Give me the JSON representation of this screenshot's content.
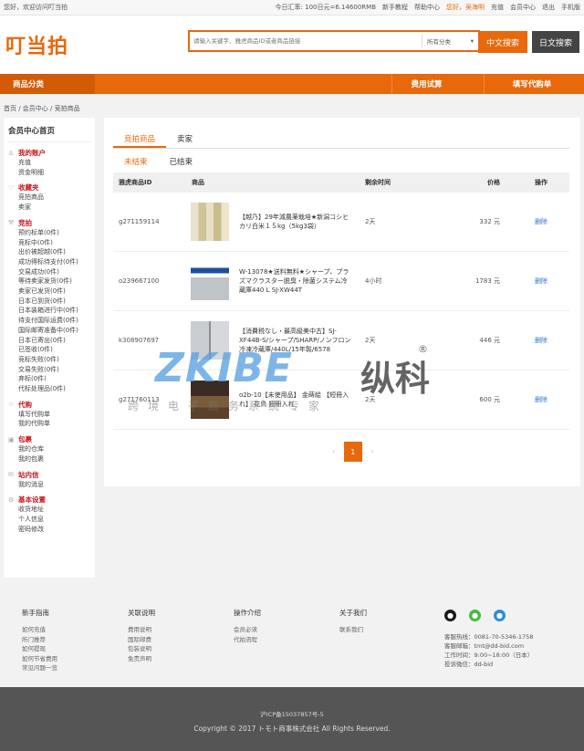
{
  "topbar": {
    "welcome": "您好，欢迎访问叮当拍",
    "rate": "今日汇率: 100日元=6.14600RMB",
    "links": [
      "新手教程",
      "帮助中心"
    ],
    "greeting": "您好，吴海明",
    "links2": [
      "充值",
      "会员中心",
      "退出",
      "手机版"
    ]
  },
  "header": {
    "logo": "叮当拍",
    "search_placeholder": "请输入关键字、雅虎商品ID或者商品链接",
    "category": "所有分类",
    "btn_cn": "中文搜索",
    "btn_jp": "日文搜索"
  },
  "nav": {
    "category_title": "商品分类",
    "items": [
      "费用试算",
      "填写代购单"
    ]
  },
  "breadcrumb": "首页 / 会员中心 / 竞拍商品",
  "sidebar": {
    "home": "会员中心首页",
    "groups": [
      {
        "title": "我的账户",
        "icon": "user-icon",
        "items": [
          "充值",
          "资金明细"
        ]
      },
      {
        "title": "收藏夹",
        "icon": "heart-icon",
        "items": [
          "竞拍商品",
          "卖家"
        ]
      },
      {
        "title": "竞拍",
        "icon": "gavel-icon",
        "items": [
          "预约标单(0件)",
          "竞标中(0件)",
          "出价被超越(0件)",
          "成功得标待支付(0件)",
          "交易成功(0件)",
          "等待卖家发货(0件)",
          "卖家已发货(0件)",
          "日本已到货(0件)",
          "日本装箱进行中(0件)",
          "待支付国际运费(0件)",
          "国际邮寄准备中(0件)",
          "日本已寄出(0件)",
          "已签收(0件)",
          "竞标失败(0件)",
          "交易失败(0件)",
          "弃标(0件)",
          "代标处理品(0件)"
        ]
      },
      {
        "title": "代购",
        "icon": "star-icon",
        "items": [
          "填写代购单",
          "我的代购单"
        ]
      },
      {
        "title": "包裹",
        "icon": "package-icon",
        "items": [
          "我的仓库",
          "我的包裹"
        ]
      },
      {
        "title": "站内信",
        "icon": "mail-icon",
        "items": [
          "我的消息"
        ]
      },
      {
        "title": "基本设置",
        "icon": "settings-icon",
        "items": [
          "收货地址",
          "个人信息",
          "密码修改"
        ]
      }
    ]
  },
  "main": {
    "tabs": [
      "竞拍商品",
      "卖家"
    ],
    "subtabs": [
      "未结束",
      "已结束"
    ],
    "columns": [
      "雅虎商品ID",
      "商品",
      "剩余时间",
      "价格",
      "操作"
    ],
    "rows": [
      {
        "id": "g271159114",
        "title": "【越乃】29年減農薬栽培★新潟コシヒカリ白米１５kg（5kg3袋）",
        "time": "2天",
        "price": "332 元",
        "op": "删除"
      },
      {
        "id": "o239667100",
        "title": "W-13078★送料無料★シャープ、プラズマクラスター脱臭・除菌システム冷蔵庫440 L SJ-XW44T",
        "time": "4小时",
        "price": "1783 元",
        "op": "删除"
      },
      {
        "id": "k308907697",
        "title": "【消費税なし・最高級美中古】SJ-XF44B-S/シャープ/SHARP/ノンフロン冷凍冷蔵庫/440L/15年製/6578",
        "time": "2天",
        "price": "446 元",
        "op": "删除"
      },
      {
        "id": "g271760113",
        "title": "o2b-10【未使用品】 金蒔絵 【短冊入れ】 花鳥 短冊入れ",
        "time": "2天",
        "price": "600 元",
        "op": "删除"
      }
    ],
    "page": "1",
    "prev": "‹",
    "next": "›"
  },
  "watermark": {
    "logo": "ZKIBE",
    "cn": "纵科",
    "reg": "®",
    "sub": "跨境电子商务系统专家"
  },
  "footer": {
    "cols": [
      {
        "title": "新手指南",
        "items": [
          "如何充值",
          "所门推荐",
          "如何提现",
          "如何节省费用",
          "常见问题一览"
        ]
      },
      {
        "title": "关联说明",
        "items": [
          "费用说明",
          "国际邮费",
          "包装说明",
          "免责声明"
        ]
      },
      {
        "title": "操作介绍",
        "items": [
          "会员必读",
          "代拍流程"
        ]
      },
      {
        "title": "关于我们",
        "items": [
          "联系我们"
        ]
      }
    ],
    "contact": [
      "客服热线：0081-70-5346-1758",
      "客服邮箱：tmt@dd-bid.com",
      "工作时间：9:00~18:00（日本）",
      "投诉微信：dd-bid"
    ],
    "icp": "沪ICP备15037857号-5",
    "copyright": "Copyright © 2017 トモト商事株式会社 All Rights Reserved."
  },
  "colors": {
    "accent": "#e8680c",
    "link": "#2a75d6",
    "danger": "#c8161d"
  }
}
